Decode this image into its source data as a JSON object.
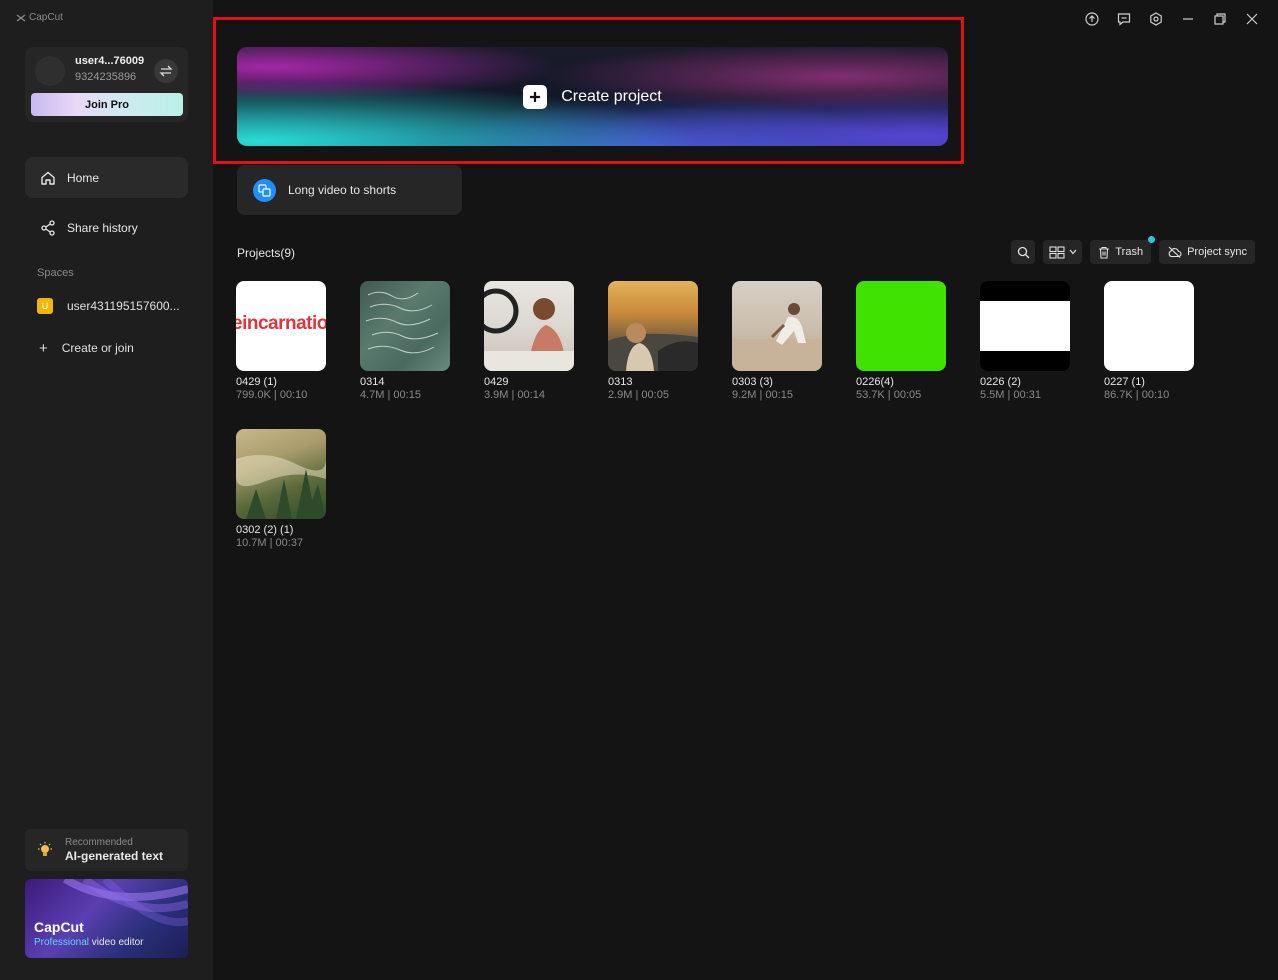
{
  "app": {
    "title": "CapCut"
  },
  "user": {
    "name": "user4...76009",
    "id": "9324235896",
    "join_pro": "Join Pro"
  },
  "nav": [
    {
      "label": "Home",
      "icon": "home-icon"
    },
    {
      "label": "Share history",
      "icon": "share-icon"
    }
  ],
  "spaces": {
    "label": "Spaces",
    "item": {
      "badge": "U",
      "label": "user431195157600..."
    },
    "create_join": "Create or join"
  },
  "recommended": {
    "label": "Recommended",
    "title": "AI-generated text"
  },
  "promo": {
    "title": "CapCut",
    "subtitle_accent": "Professional",
    "subtitle_rest": " video editor"
  },
  "main": {
    "create_project": "Create project",
    "long_video": "Long video to shorts",
    "projects_title": "Projects(9)",
    "toolbar": {
      "trash": "Trash",
      "sync": "Project sync"
    }
  },
  "projects": [
    {
      "name": "0429 (1)",
      "meta": "799.0K | 00:10",
      "thumb_text": "eincarnatio"
    },
    {
      "name": "0314",
      "meta": "4.7M | 00:15"
    },
    {
      "name": "0429",
      "meta": "3.9M | 00:14"
    },
    {
      "name": "0313",
      "meta": "2.9M | 00:05"
    },
    {
      "name": "0303 (3)",
      "meta": "9.2M | 00:15"
    },
    {
      "name": "0226(4)",
      "meta": "53.7K | 00:05"
    },
    {
      "name": "0226 (2)",
      "meta": "5.5M | 00:31"
    },
    {
      "name": "0227 (1)",
      "meta": "86.7K | 00:10"
    },
    {
      "name": "0302 (2) (1)",
      "meta": "10.7M | 00:37"
    }
  ],
  "colors": {
    "highlight": "#e3101a",
    "accent_blue": "#1f8fff",
    "notify_dot": "#21c8e0"
  }
}
